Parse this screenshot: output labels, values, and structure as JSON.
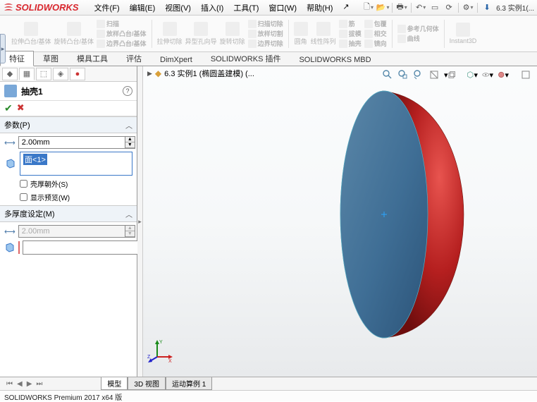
{
  "title": {
    "app": "SOLIDWORKS"
  },
  "doc": "6.3 实例1(...",
  "menu": [
    "文件(F)",
    "编辑(E)",
    "视图(V)",
    "插入(I)",
    "工具(T)",
    "窗口(W)",
    "帮助(H)",
    "↗"
  ],
  "ribbon": {
    "groups": [
      {
        "label": "拉伸凸台/基体"
      },
      {
        "label": "旋转凸台/基体"
      }
    ],
    "col1": [
      "扫描",
      "放样凸台/基体",
      "边界凸台/基体"
    ],
    "cut": [
      {
        "label": "拉伸切除"
      },
      {
        "label": "异型孔向导"
      },
      {
        "label": "旋转切除"
      }
    ],
    "col2": [
      "扫描切除",
      "放样切割",
      "边界切除"
    ],
    "feat": [
      {
        "label": "圆角"
      },
      {
        "label": "线性阵列"
      }
    ],
    "col3": [
      "筋",
      "拔模",
      "抽壳"
    ],
    "col4": [
      "包覆",
      "相交",
      "镜向"
    ],
    "ref": [
      "参考几何体",
      "曲线"
    ],
    "inst": "Instant3D"
  },
  "tabs": [
    "特征",
    "草图",
    "模具工具",
    "评估",
    "DimXpert",
    "SOLIDWORKS 插件",
    "SOLIDWORKS MBD"
  ],
  "breadcrumb": {
    "text": "6.3 实例1 (椭圆盖建模)   (..."
  },
  "feature": {
    "title": "抽壳1",
    "params_h": "参数(P)",
    "thickness": "2.00mm",
    "face": "面<1>",
    "cb1": "壳厚朝外(S)",
    "cb2": "显示预览(W)",
    "multi_h": "多厚度设定(M)",
    "thickness2": "2.00mm"
  },
  "bottabs": [
    "模型",
    "3D 视图",
    "运动算例 1"
  ],
  "status": "SOLIDWORKS Premium 2017 x64 版"
}
